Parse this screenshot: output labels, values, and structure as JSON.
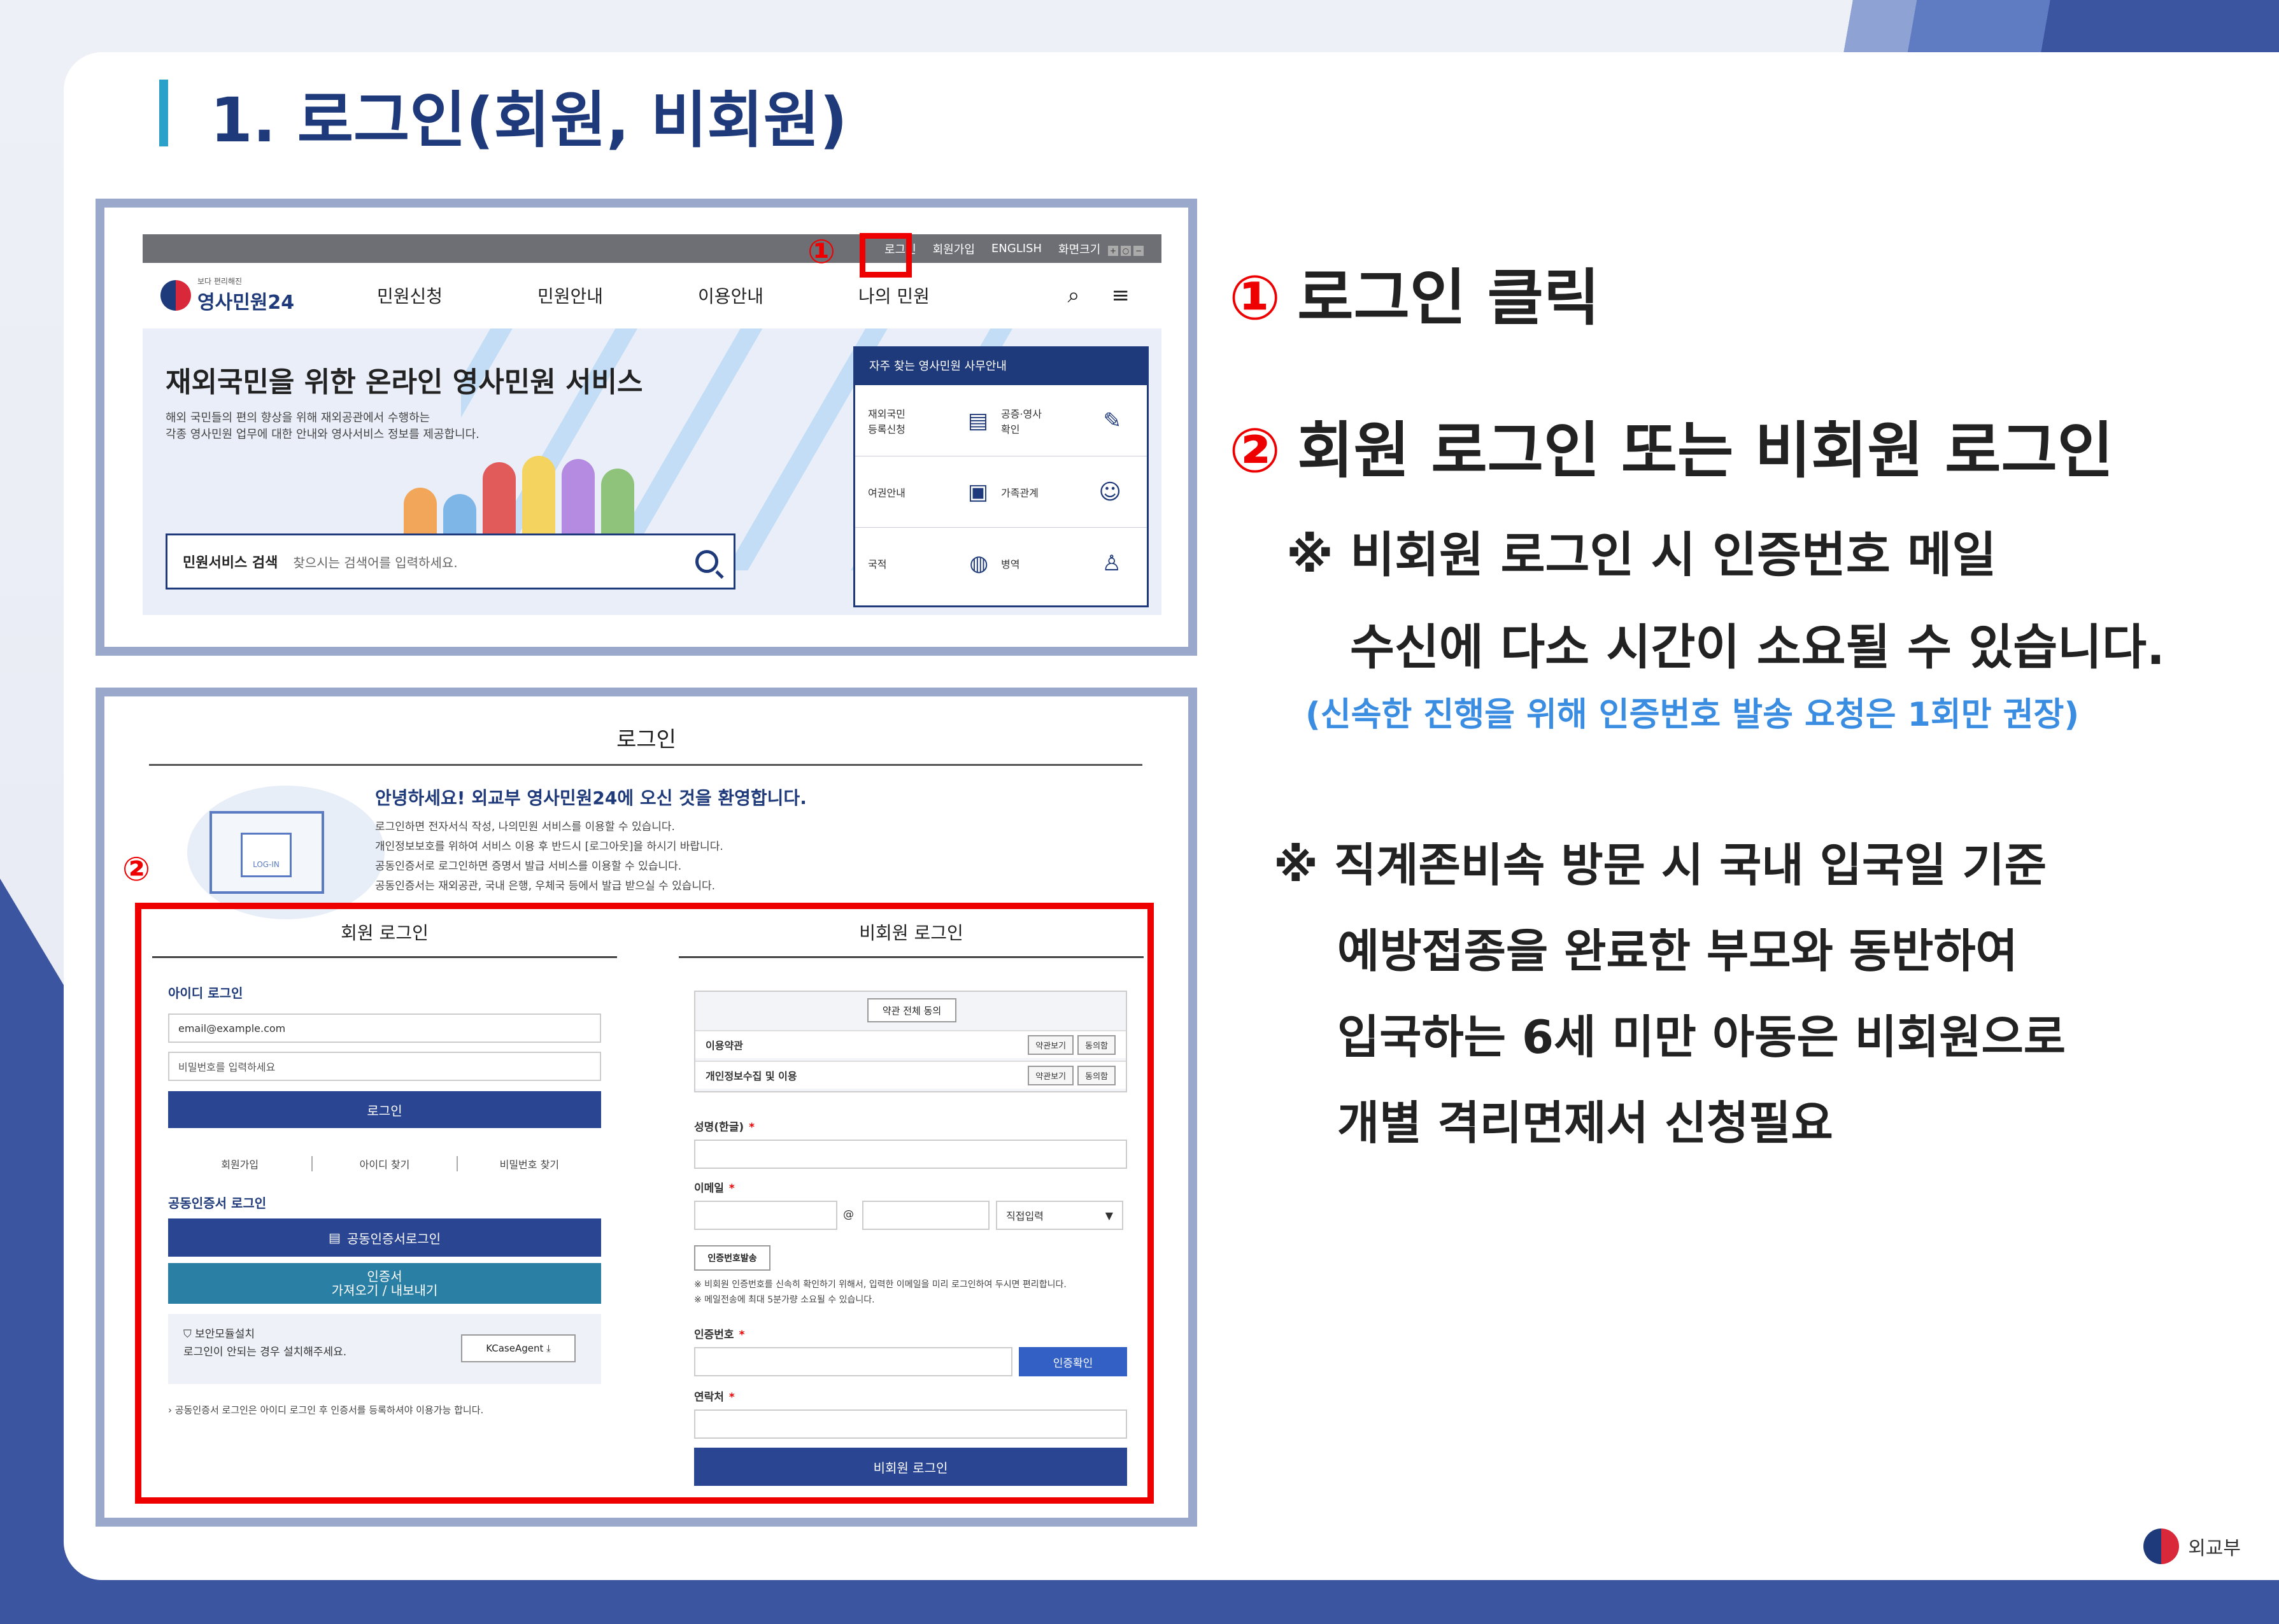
{
  "slide": {
    "title": "1. 로그인(회원, 비회원)",
    "footer_org": "외교부"
  },
  "portal": {
    "topbar": [
      "로그인",
      "회원가입",
      "ENGLISH",
      "화면크기"
    ],
    "logo_sub": "보다 편리해진",
    "logo_main": "영사민원24",
    "nav": [
      "민원신청",
      "민원안내",
      "이용안내",
      "나의 민원"
    ],
    "hero_title": "재외국민을 위한 온라인 영사민원 서비스",
    "hero_desc_1": "해외 국민들의 편의 향상을 위해 재외공관에서 수행하는",
    "hero_desc_2": "각종 영사민원 업무에 대한 안내와 영사서비스 정보를 제공합니다.",
    "search_label": "민원서비스 검색",
    "search_placeholder": "찾으시는 검색어를 입력하세요.",
    "office_title": "자주 찾는 영사민원 사무안내",
    "office_items": [
      [
        "재외국민\n등록신청",
        "공증·영사\n확인"
      ],
      [
        "여권안내",
        "가족관계"
      ],
      [
        "국적",
        "병역"
      ]
    ],
    "marker": "①"
  },
  "login": {
    "page_title": "로그인",
    "welcome": "안녕하세요! 외교부 영사민원24에 오신 것을 환영합니다.",
    "welcome_lines": [
      "로그인하면 전자서식 작성, 나의민원 서비스를 이용할 수 있습니다.",
      "개인정보보호를 위하여 서비스 이용 후 반드시 [로그아웃]을 하시기 바랍니다.",
      "공동인증서로 로그인하면 증명서 발급 서비스를 이용할 수 있습니다.",
      "공동인증서는 재외공관, 국내 은행, 우체국 등에서 발급 받으실 수 있습니다."
    ],
    "illust_badge": "LOG-IN",
    "marker": "②",
    "member": {
      "heading": "회원 로그인",
      "id_section": "아이디 로그인",
      "id_value": "email@example.com",
      "pw_placeholder": "비밀번호를 입력하세요",
      "login_btn": "로그인",
      "links": [
        "회원가입",
        "아이디 찾기",
        "비밀번호 찾기"
      ],
      "cert_section": "공동인증서 로그인",
      "cert_btn": "공동인증서로그인",
      "cert_io_1": "인증서",
      "cert_io_2": "가져오기 / 내보내기",
      "secmod_title": "보안모듈설치",
      "secmod_desc": "로그인이 안되는 경우 설치해주세요.",
      "kcase": "KCaseAgent ⤓",
      "note": "› 공동인증서 로그인은 아이디 로그인 후 인증서를 등록하셔야 이용가능 합니다."
    },
    "guest": {
      "heading": "비회원 로그인",
      "agree_all": "약관 전체 동의",
      "terms": [
        "이용약관",
        "개인정보수집 및 이용"
      ],
      "view_btn": "약관보기",
      "agree_btn": "동의함",
      "name_label": "성명(한글)",
      "email_label": "이메일",
      "at": "@",
      "domain_select": "직접입력",
      "send_code_btn": "인증번호발송",
      "hint_1": "※ 비회원 인증번호를 신속히 확인하기 위해서, 입력한 이메일을 미리 로그인하여 두시면 편리합니다.",
      "hint_2": "※ 메일전송에 최대 5분가량 소요될 수 있습니다.",
      "code_label": "인증번호",
      "verify_btn": "인증확인",
      "contact_label": "연락처",
      "guest_login_btn": "비회원 로그인",
      "req": "*"
    }
  },
  "instructions": {
    "step1_num": "①",
    "step1": "로그인 클릭",
    "step2_num": "②",
    "step2": "회원 로그인 또는 비회원 로그인",
    "note_a1": "※ 비회원 로그인 시 인증번호 메일",
    "note_a2": "수신에 다소 시간이 소요될 수 있습니다.",
    "note_a3": "(신속한 진행을 위해 인증번호 발송 요청은 1회만 권장)",
    "note_b1": "※ 직계존비속 방문 시 국내 입국일 기준",
    "note_b2": "예방접종을 완료한 부모와 동반하여",
    "note_b3": "입국하는 6세 미만 아동은 비회원으로",
    "note_b4": "개별 격리면제서 신청필요"
  },
  "colors": {
    "navy": "#1f3a7a",
    "highlight_red": "#e00000",
    "note_blue": "#3a8de0",
    "title_accent": "#2ba0c8"
  }
}
